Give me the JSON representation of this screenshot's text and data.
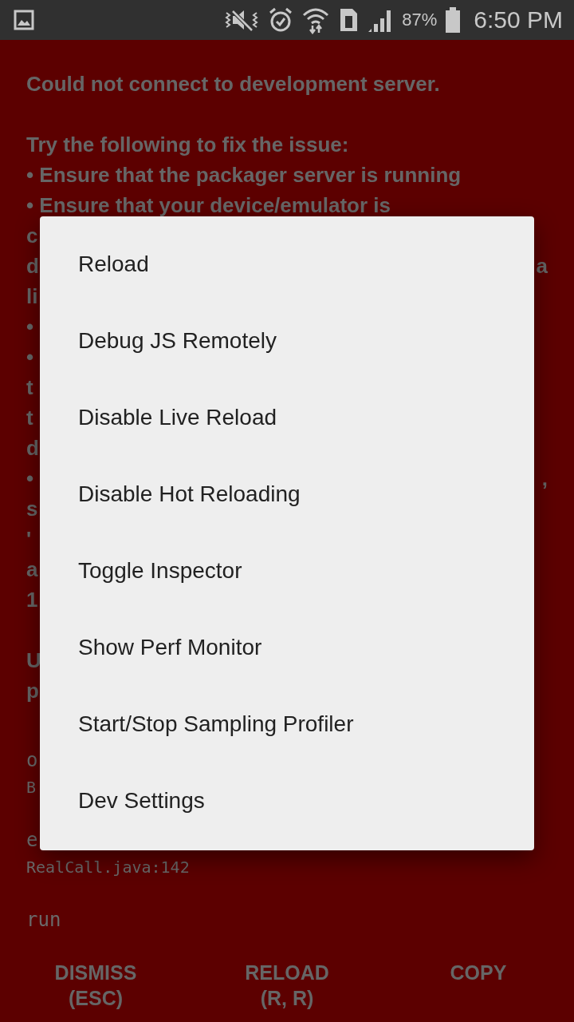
{
  "status_bar": {
    "battery": "87%",
    "time": "6:50 PM"
  },
  "error_screen": {
    "paragraphs": [
      [
        {
          "text": "Could not connect to development server."
        }
      ],
      [
        {
          "text": "Try the following to fix the issue:"
        },
        {
          "text": "• Ensure that the packager server is running"
        },
        {
          "text": "• Ensure that your device/emulator is"
        },
        {
          "text": "c"
        },
        {
          "text": "d",
          "right_text": "a"
        },
        {
          "text": "li"
        },
        {
          "text": "•"
        },
        {
          "text": "•"
        },
        {
          "text": "t"
        },
        {
          "text": "t"
        },
        {
          "text": "d"
        },
        {
          "text": "•",
          "right_text": ","
        },
        {
          "text": "s"
        },
        {
          "text": "'"
        },
        {
          "text": "a"
        },
        {
          "text": "1"
        }
      ],
      [
        {
          "text": "U"
        },
        {
          "text": "p"
        }
      ]
    ],
    "stack_trace": [
      {
        "method": "o",
        "location": "B"
      },
      {
        "method": "e",
        "location": "RealCall.java:142"
      },
      {
        "method": "run"
      }
    ],
    "buttons": [
      {
        "label": "DISMISS\n(ESC)"
      },
      {
        "label": "RELOAD\n(R, R)"
      },
      {
        "label": "COPY"
      }
    ]
  },
  "dev_menu": {
    "items": [
      "Reload",
      "Debug JS Remotely",
      "Disable Live Reload",
      "Disable Hot Reloading",
      "Toggle Inspector",
      "Show Perf Monitor",
      "Start/Stop Sampling Profiler",
      "Dev Settings"
    ]
  }
}
